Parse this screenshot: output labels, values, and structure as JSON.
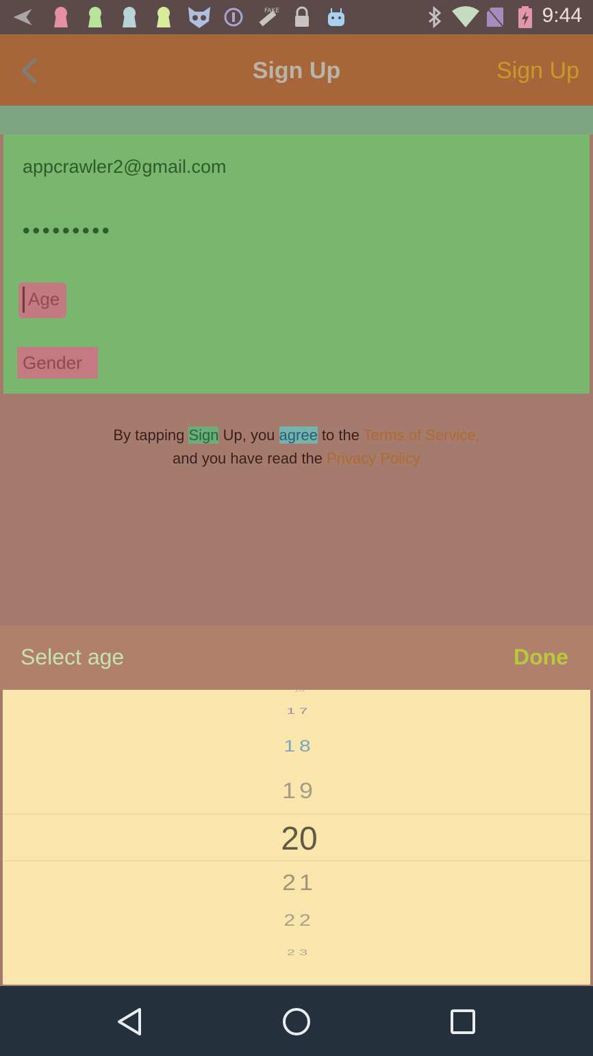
{
  "status_bar": {
    "time": "9:44",
    "left_icons": [
      "navigation-icon",
      "keyhole-icon",
      "keyhole-icon",
      "keyhole-icon",
      "keyhole-icon",
      "cat-icon",
      "info-icon",
      "fake-gps-icon",
      "lock-icon",
      "android-icon"
    ],
    "right_icons": [
      "bluetooth-icon",
      "wifi-icon",
      "no-sim-icon",
      "battery-charging-icon"
    ],
    "fake_gps_label": "FAKE"
  },
  "app_bar": {
    "title": "Sign Up",
    "action_label": "Sign Up"
  },
  "form": {
    "email_value": "appcrawler2@gmail.com",
    "password_value": "•••••••••",
    "age_placeholder": "Age",
    "gender_placeholder": "Gender"
  },
  "terms": {
    "part1": "By tapping ",
    "sign_up": "Sign",
    "part2": " Up, you ",
    "agree": "agree",
    "part3": " to the ",
    "terms_link": "Terms of Service,",
    "part4": "and you have read the ",
    "privacy_link": "Privacy Policy"
  },
  "picker": {
    "header_label": "Select age",
    "done_label": "Done",
    "values": [
      "17",
      "18",
      "19",
      "20",
      "21",
      "22",
      "23"
    ],
    "selected_value": "20"
  },
  "colors": {
    "status_bar": "#5c4a4a",
    "app_bar": "#a7663a",
    "form_bg": "#79b66e",
    "terms_bg": "#a57b6e",
    "picker_bg": "#fae5ad",
    "nav_bar": "#25303d",
    "done": "#b9c93d"
  }
}
